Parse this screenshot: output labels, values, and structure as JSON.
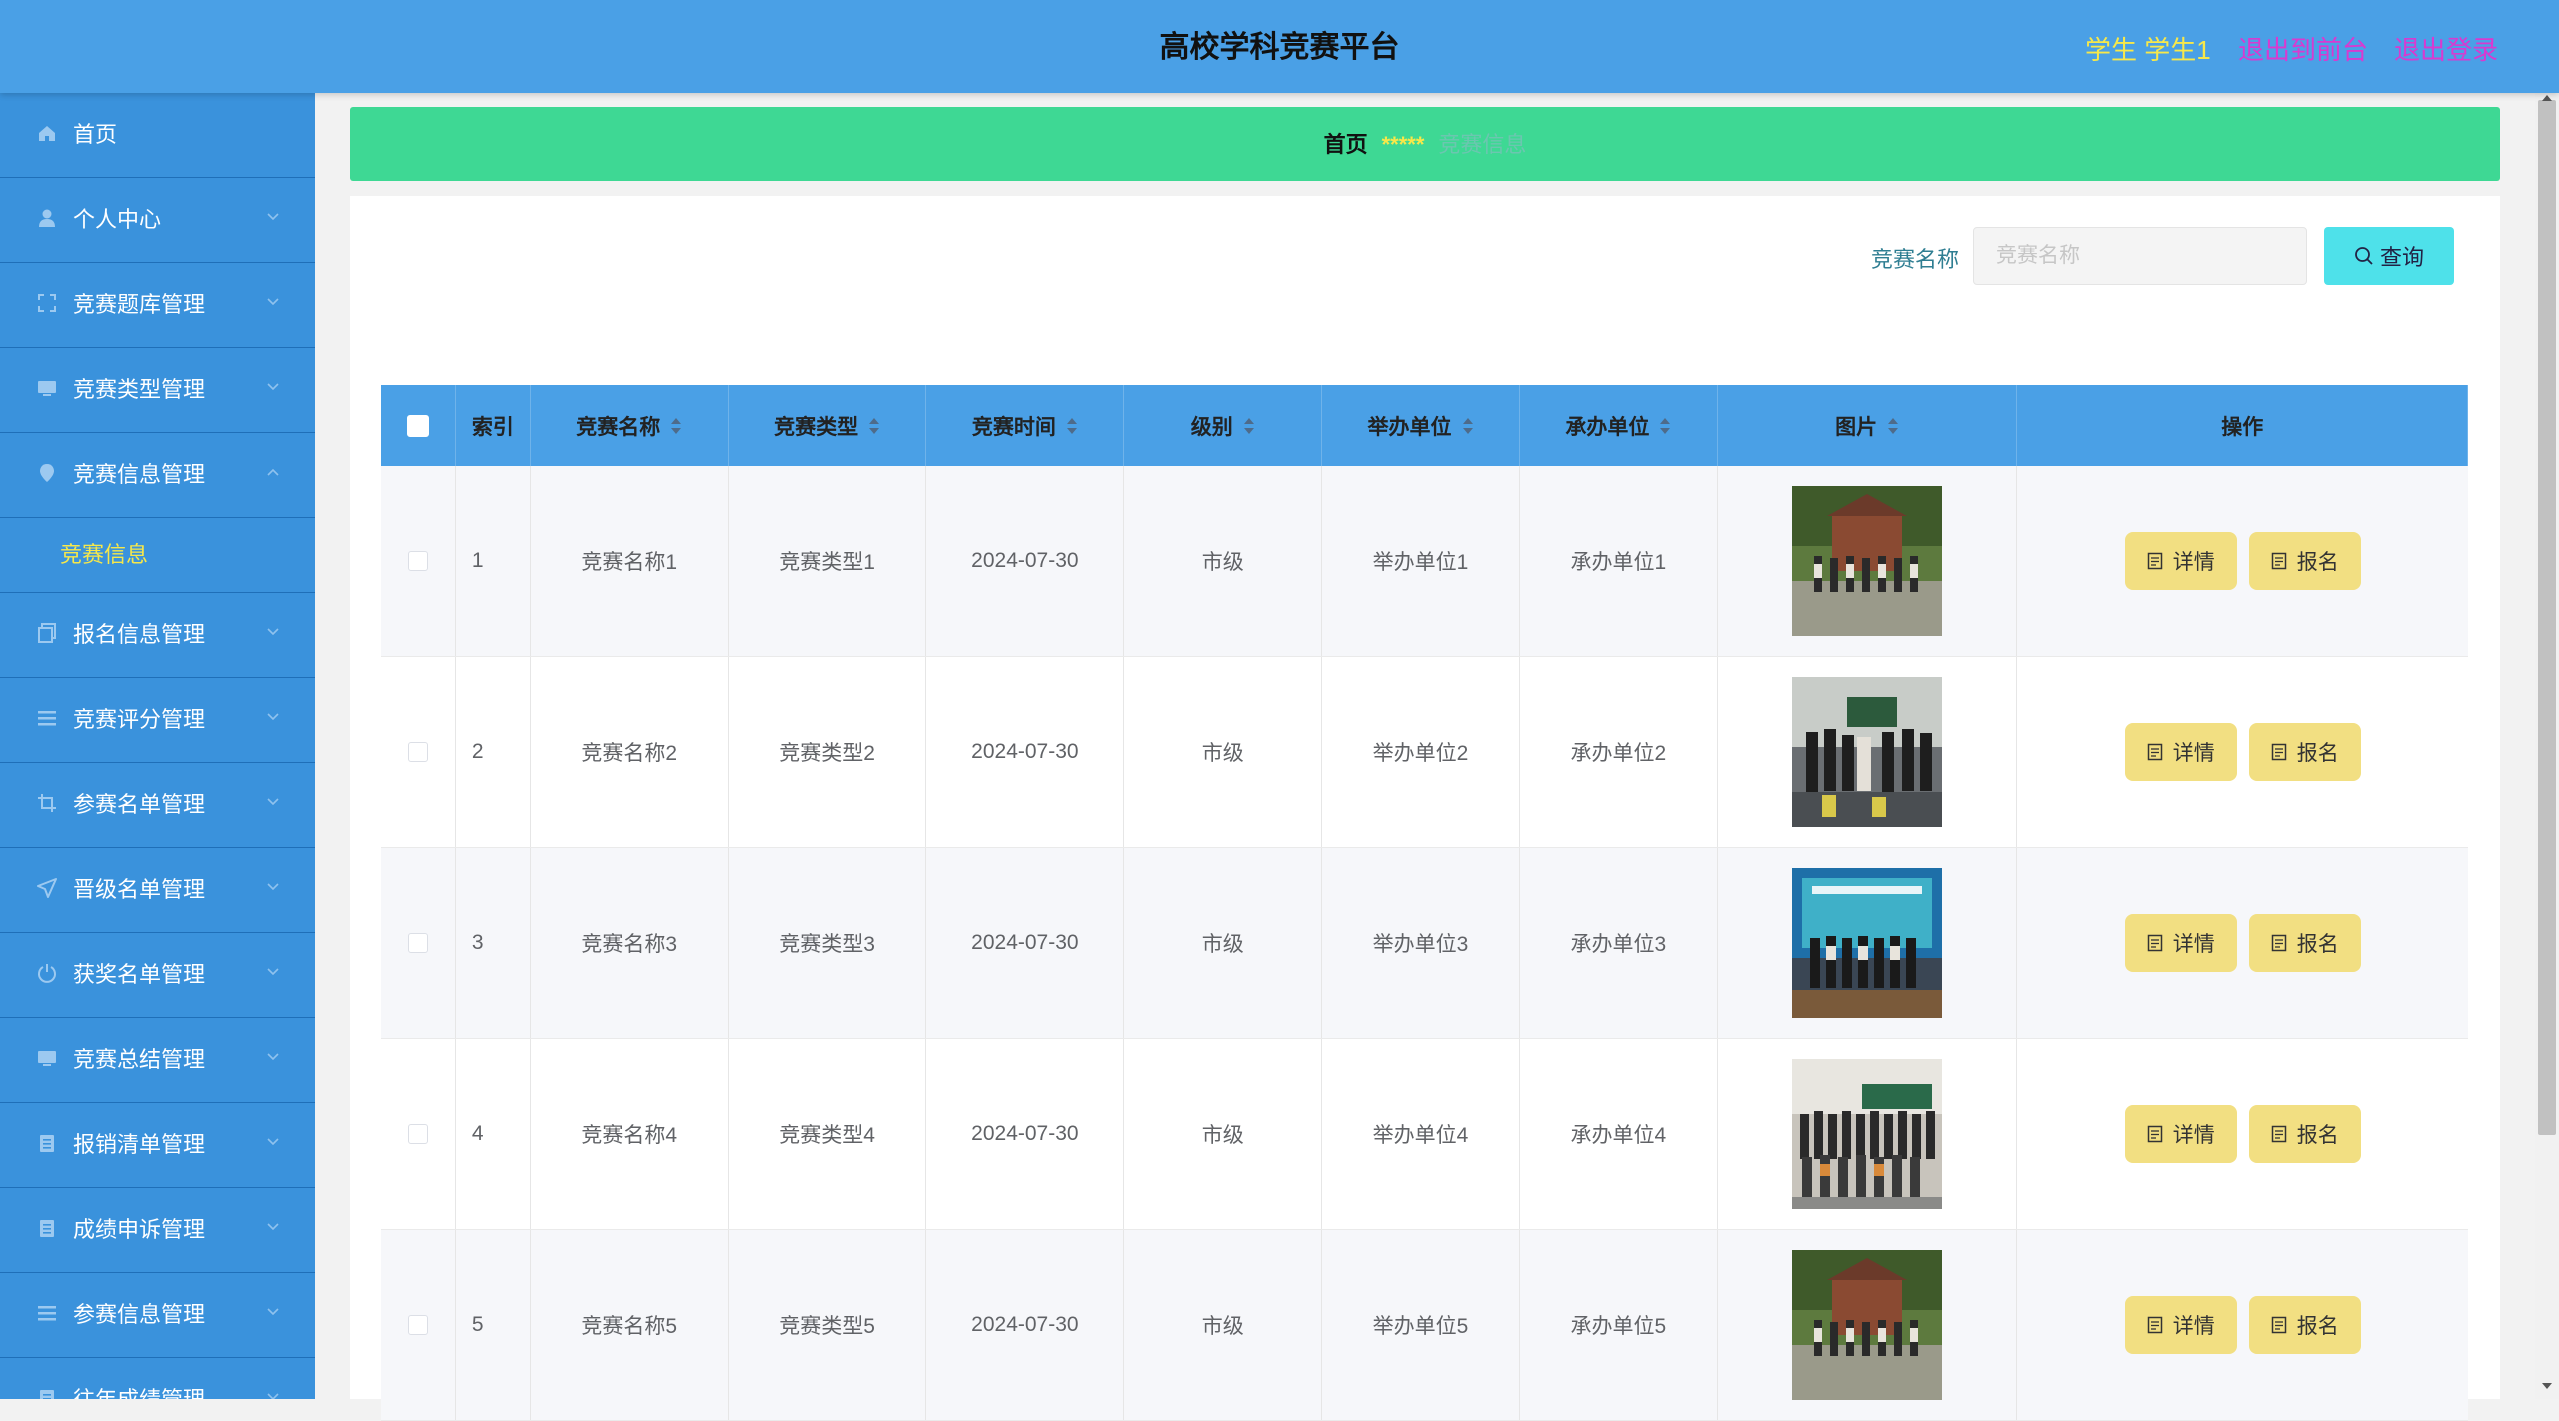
{
  "header": {
    "title": "高校学科竞赛平台",
    "user": "学生 学生1",
    "to_front_label": "退出到前台",
    "logout_label": "退出登录"
  },
  "sidebar": {
    "items": [
      {
        "label": "首页",
        "icon": "home-icon"
      },
      {
        "label": "个人中心",
        "icon": "user-icon"
      },
      {
        "label": "竞赛题库管理",
        "icon": "frame-icon"
      },
      {
        "label": "竞赛类型管理",
        "icon": "monitor-icon"
      },
      {
        "label": "竞赛信息管理",
        "icon": "location-icon"
      },
      {
        "label": "报名信息管理",
        "icon": "copy-icon"
      },
      {
        "label": "竞赛评分管理",
        "icon": "list-icon"
      },
      {
        "label": "参赛名单管理",
        "icon": "crop-icon"
      },
      {
        "label": "晋级名单管理",
        "icon": "send-icon"
      },
      {
        "label": "获奖名单管理",
        "icon": "power-icon"
      },
      {
        "label": "竞赛总结管理",
        "icon": "monitor-icon"
      },
      {
        "label": "报销清单管理",
        "icon": "document-icon"
      },
      {
        "label": "成绩申诉管理",
        "icon": "document-icon"
      },
      {
        "label": "参赛信息管理",
        "icon": "list-icon"
      },
      {
        "label": "往年成绩管理",
        "icon": "document-icon"
      }
    ],
    "submenu_active": "竞赛信息"
  },
  "breadcrumb": {
    "home": "首页",
    "separator": "*****",
    "current": "竞赛信息"
  },
  "search": {
    "label": "竞赛名称",
    "placeholder": "竞赛名称",
    "button_label": "查询"
  },
  "table": {
    "columns": [
      "索引",
      "竞赛名称",
      "竞赛类型",
      "竞赛时间",
      "级别",
      "举办单位",
      "承办单位",
      "图片",
      "操作"
    ],
    "detail_label": "详情",
    "signup_label": "报名",
    "rows": [
      {
        "index": "1",
        "name": "竞赛名称1",
        "type": "竞赛类型1",
        "date": "2024-07-30",
        "level": "市级",
        "host": "举办单位1",
        "organizer": "承办单位1"
      },
      {
        "index": "2",
        "name": "竞赛名称2",
        "type": "竞赛类型2",
        "date": "2024-07-30",
        "level": "市级",
        "host": "举办单位2",
        "organizer": "承办单位2"
      },
      {
        "index": "3",
        "name": "竞赛名称3",
        "type": "竞赛类型3",
        "date": "2024-07-30",
        "level": "市级",
        "host": "举办单位3",
        "organizer": "承办单位3"
      },
      {
        "index": "4",
        "name": "竞赛名称4",
        "type": "竞赛类型4",
        "date": "2024-07-30",
        "level": "市级",
        "host": "举办单位4",
        "organizer": "承办单位4"
      },
      {
        "index": "5",
        "name": "竞赛名称5",
        "type": "竞赛类型5",
        "date": "2024-07-30",
        "level": "市级",
        "host": "举办单位5",
        "organizer": "承办单位5"
      }
    ]
  },
  "colors": {
    "header_bg": "#4aa0e6",
    "sidebar_bg": "#3a92dc",
    "breadcrumb_bg": "#3ed894",
    "user_text": "#f7e84a",
    "link_text": "#d83ad0",
    "search_button": "#4ee1ea",
    "action_button": "#f2df82"
  }
}
